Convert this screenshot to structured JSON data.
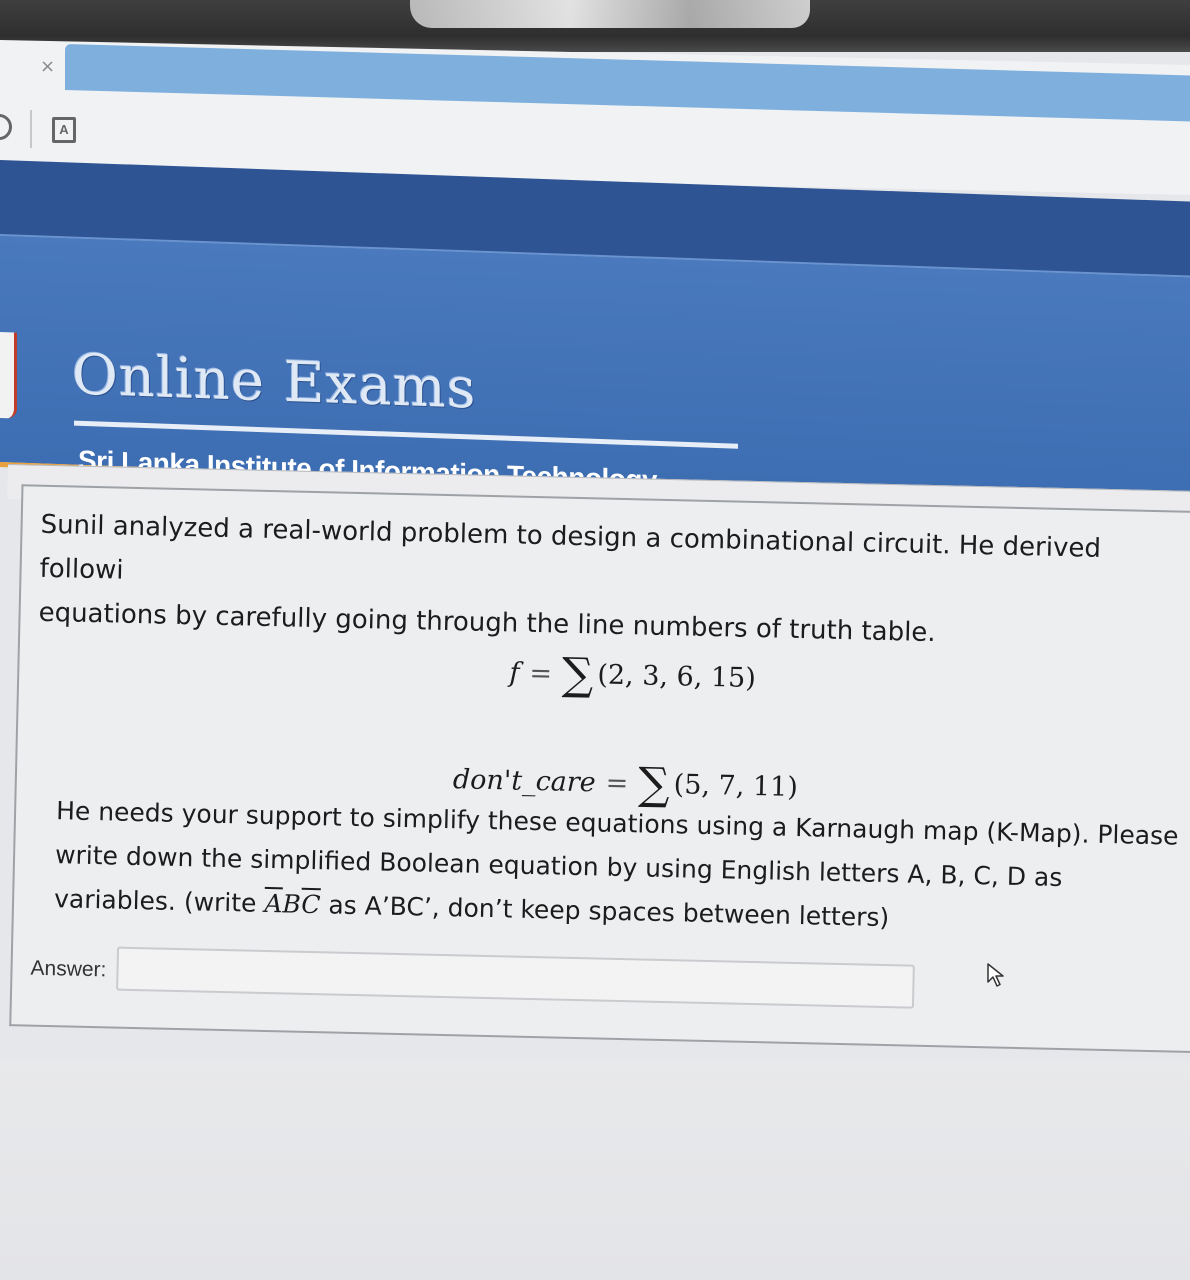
{
  "browser": {
    "tab_close_glyph": "×",
    "page_icon_glyph": "A"
  },
  "header": {
    "title": "Online Exams",
    "subtitle": "Sri Lanka Institute of Information Technology"
  },
  "question": {
    "intro": "Sunil analyzed a real-world problem to design a combinational circuit. He derived followi\nequations by carefully going through the line numbers of truth table.",
    "equation_f": {
      "lhs": "f",
      "equals": "=",
      "sigma": "∑",
      "terms": "(2, 3, 6, 15)"
    },
    "equation_dont_care": {
      "lhs": "don't_care",
      "equals": "=",
      "sigma": "∑",
      "terms": "(5, 7, 11)"
    },
    "instructions_part1": "He needs your support to simplify these equations using a Karnaugh map (K-Map). Please write down the simplified Boolean equation by using English letters A, B, C, D as variables. (write ",
    "example_a_bar": "A",
    "example_b": "B",
    "example_c_bar": "C",
    "instructions_part2": " as A’BC’, don’t keep spaces between letters)"
  },
  "answer": {
    "label": "Answer:",
    "value": "",
    "placeholder": ""
  },
  "colors": {
    "header_blue": "#3d6db2",
    "header_dark_blue": "#2f5494",
    "accent_orange": "#e9a23e",
    "tab_blue": "#7fb0dd"
  },
  "icons": [
    "close-icon",
    "back-icon",
    "page-icon",
    "cursor-icon",
    "sigma-icon"
  ]
}
